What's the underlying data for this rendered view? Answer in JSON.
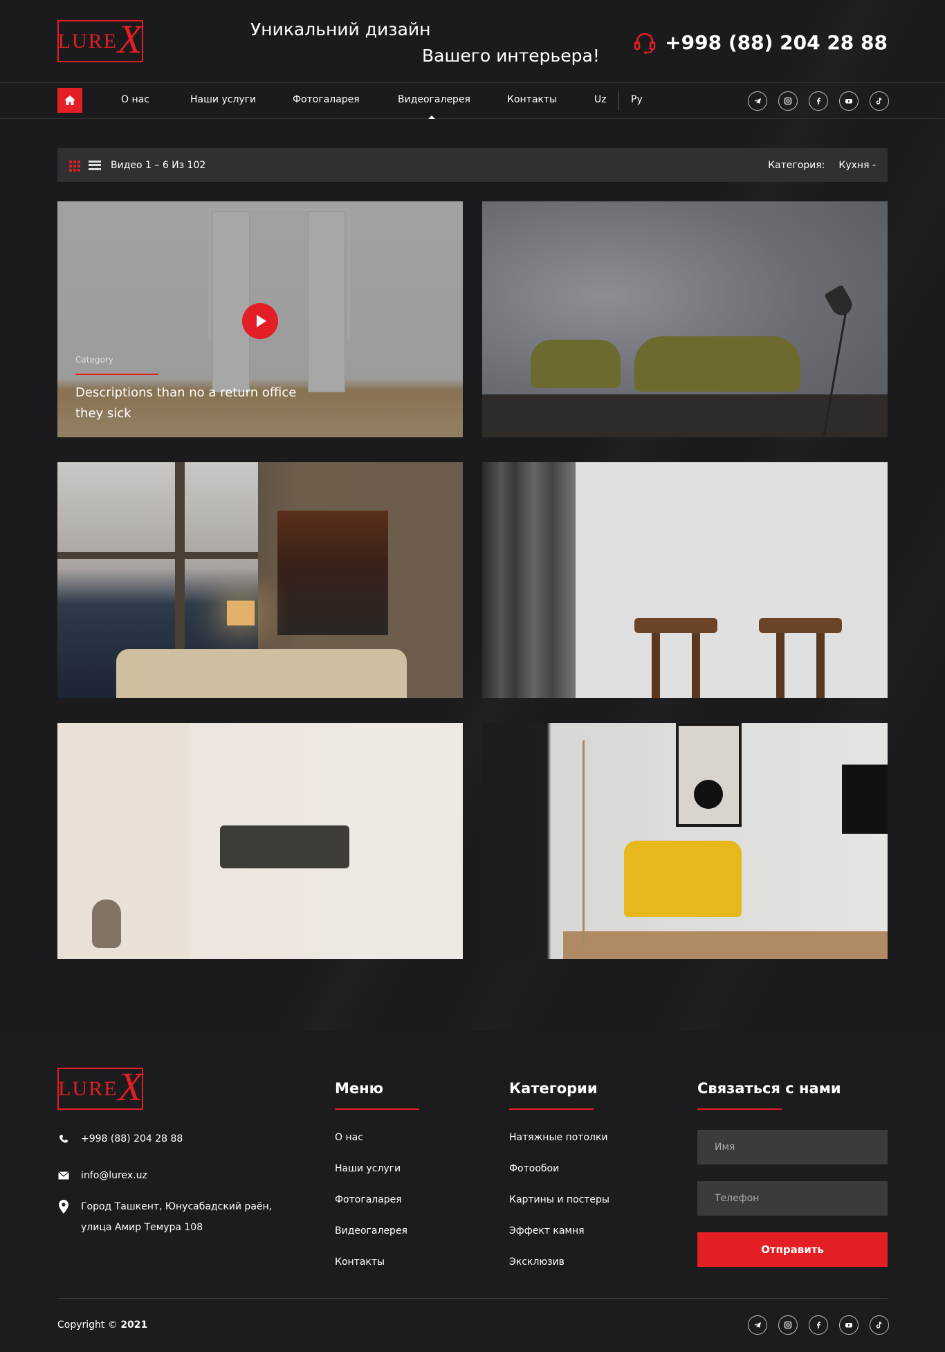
{
  "header": {
    "logo_text": "LUREX",
    "tagline_line1": "Уникальний дизайн",
    "tagline_line2": "Вашего интерьера!",
    "phone": "+998 (88) 204 28 88"
  },
  "nav": {
    "items": [
      {
        "label": "О нас"
      },
      {
        "label": "Наши услуги"
      },
      {
        "label": "Фотогаларея"
      },
      {
        "label": "Видеогалерея",
        "active": true
      },
      {
        "label": "Контакты"
      }
    ],
    "lang_uz": "Uz",
    "lang_ru": "Ру",
    "socials": [
      "telegram-icon",
      "instagram-icon",
      "facebook-icon",
      "youtube-icon",
      "tiktok-icon"
    ]
  },
  "toolbar": {
    "count_text": "Видео 1 – 6 Из 102",
    "category_label": "Категория:",
    "category_value": "Кухня -"
  },
  "gallery": {
    "featured": {
      "category": "Category",
      "description": "Descriptions than no a return office they sick"
    },
    "tiles": [
      {
        "image": "white room with open doors"
      },
      {
        "image": "olive chairs against grey wall"
      },
      {
        "image": "living room at dusk with sofa"
      },
      {
        "image": "wooden stools by curtain"
      },
      {
        "image": "minimal room with dark sofa"
      },
      {
        "image": "yellow armchair with floor lamp"
      }
    ]
  },
  "footer": {
    "logo_text": "LUREX",
    "phone": "+998 (88) 204 28 88",
    "email": "info@lurex.uz",
    "address_line1": "Город Ташкент, Юнусабадский раён,",
    "address_line2": "улица Амир Темура 108",
    "menu_heading": "Меню",
    "menu_links": [
      "О нас",
      "Наши услуги",
      "Фотогаларея",
      "Видеогалерея",
      "Контакты"
    ],
    "categories_heading": "Категории",
    "categories_links": [
      "Натяжные потолки",
      "Фотообои",
      "Картины и постеры",
      "Эффект камня",
      "Эксклюзив"
    ],
    "contact_heading": "Связаться с нами",
    "name_placeholder": "Имя",
    "phone_placeholder": "Телефон",
    "submit_label": "Отправить",
    "copyright_prefix": "Copyright ©",
    "copyright_year": "2021"
  },
  "colors": {
    "accent": "#e31e24",
    "background": "#1b1b1d",
    "toolbar": "#303033"
  }
}
